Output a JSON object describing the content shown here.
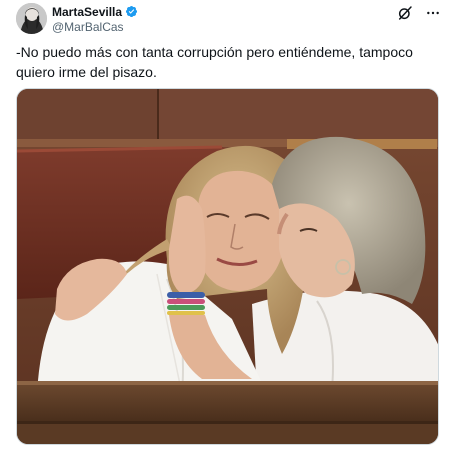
{
  "author": {
    "display_name": "MartaSevilla",
    "handle": "@MarBalCas",
    "verified": true,
    "avatar_icon": "avatar-photo"
  },
  "actions": {
    "grok_icon": "slashed-circle-icon",
    "more_icon": "more-dots-icon"
  },
  "tweet": {
    "text": "-No puedo más con tanta corrupción pero entiéndeme, tampoco quiero irme del pisazo."
  },
  "media": {
    "icon": "photo-two-women-embracing-parliament"
  },
  "colors": {
    "text": "#0f1419",
    "muted": "#536471",
    "verified": "#1d9bf0",
    "border": "#cfd9de"
  }
}
